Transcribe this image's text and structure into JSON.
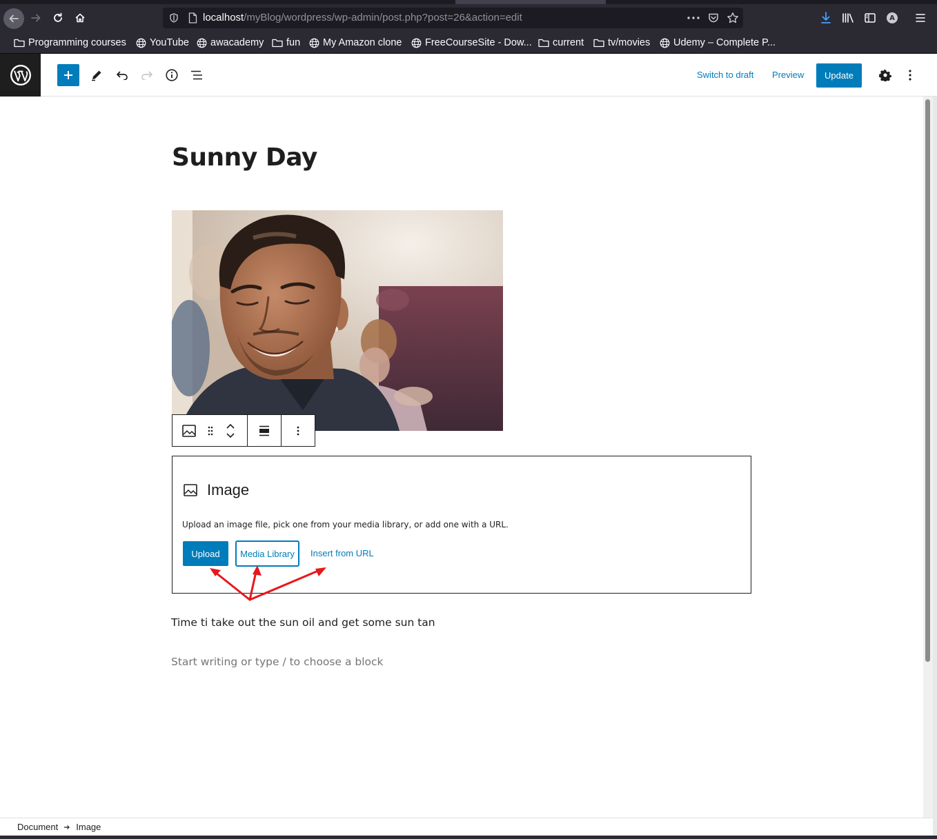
{
  "browser": {
    "url_host": "localhost",
    "url_path": "/myBlog/wordpress/wp-admin/post.php?post=26&action=edit",
    "account_initial": "A"
  },
  "bookmarks": [
    {
      "label": "Programming courses",
      "icon": "folder-icon"
    },
    {
      "label": "YouTube",
      "icon": "globe-icon"
    },
    {
      "label": "awacademy",
      "icon": "globe-icon"
    },
    {
      "label": "fun",
      "icon": "folder-icon"
    },
    {
      "label": "My Amazon clone",
      "icon": "globe-icon"
    },
    {
      "label": "FreeCourseSite - Dow...",
      "icon": "globe-icon"
    },
    {
      "label": "current",
      "icon": "folder-icon"
    },
    {
      "label": "tv/movies",
      "icon": "folder-icon"
    },
    {
      "label": "Udemy – Complete P...",
      "icon": "globe-icon"
    }
  ],
  "header": {
    "switch_to_draft": "Switch to draft",
    "preview": "Preview",
    "update": "Update"
  },
  "post": {
    "title": "Sunny Day",
    "paragraph": "Time ti take out the sun oil and get some sun tan",
    "appender_placeholder": "Start writing or type / to choose a block"
  },
  "image_block": {
    "label": "Image",
    "instructions": "Upload an image file, pick one from your media library, or add one with a URL.",
    "upload": "Upload",
    "media_library": "Media Library",
    "insert_from_url": "Insert from URL"
  },
  "breadcrumb": {
    "root": "Document",
    "current": "Image"
  },
  "colors": {
    "accent": "#007cba",
    "annotation_arrow": "#e8171b",
    "wp_logo_bg": "#1e1e1e",
    "browser_chrome": "#2b2a33"
  }
}
